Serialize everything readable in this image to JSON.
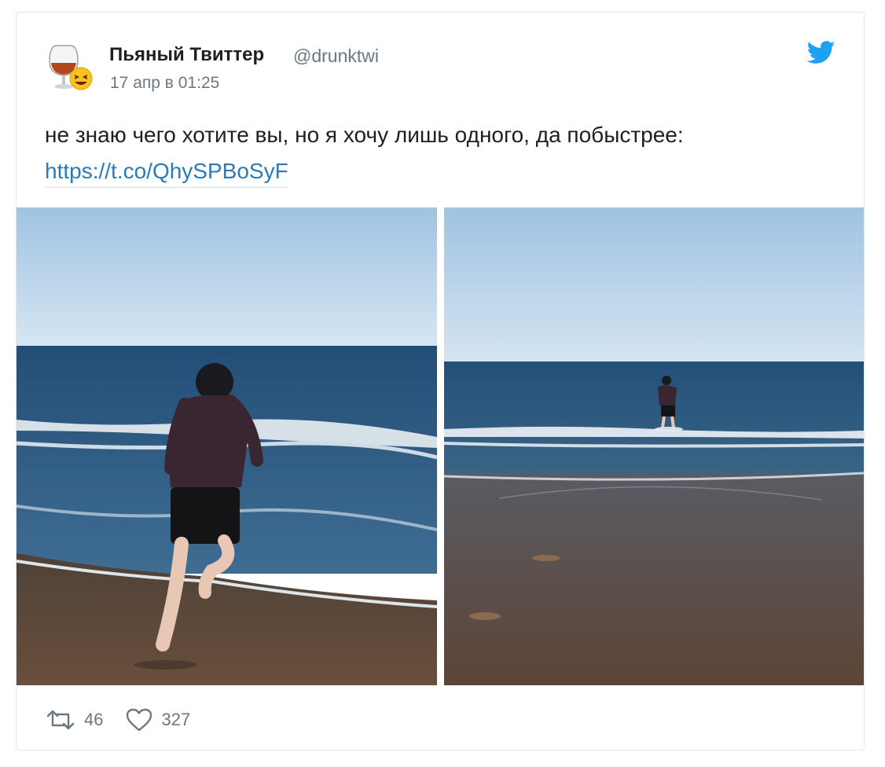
{
  "tweet": {
    "author_name": "Пьяный Твиттер",
    "author_handle": "@drunktwi",
    "timestamp": "17 апр в 01:25",
    "text": "не знаю чего хотите вы, но я хочу лишь одного, да побыстрее:",
    "link": "https://t.co/QhySPBoSyF"
  },
  "media": [
    {
      "icon": "photo-man-running-into-sea-closeup"
    },
    {
      "icon": "photo-man-in-sea-distance"
    }
  ],
  "actions": {
    "retweet_count": "46",
    "like_count": "327"
  },
  "colors": {
    "accent": "#1da1f2",
    "link": "#2b7bb9",
    "text": "#1c2022",
    "secondary": "#697882",
    "border": "#e1e8ed"
  }
}
